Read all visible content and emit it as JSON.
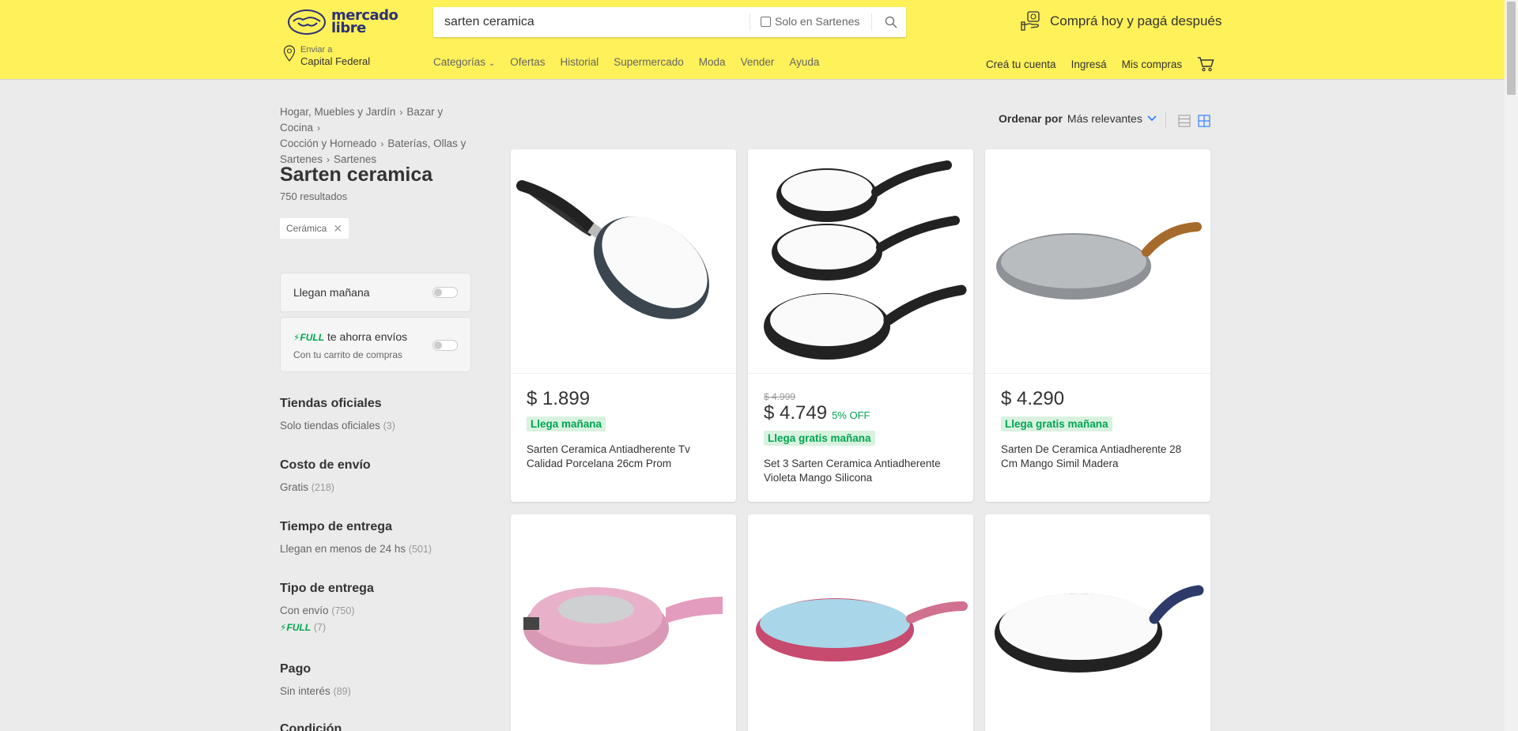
{
  "header": {
    "logo_line1": "mercado",
    "logo_line2": "libre",
    "search_value": "sarten ceramica",
    "search_check_label": "Solo en Sartenes",
    "promo_text": "Comprá hoy y pagá después",
    "location_small": "Enviar a",
    "location_main": "Capital Federal",
    "nav": [
      "Categorías",
      "Ofertas",
      "Historial",
      "Supermercado",
      "Moda",
      "Vender",
      "Ayuda"
    ],
    "account": [
      "Creá tu cuenta",
      "Ingresá",
      "Mis compras"
    ]
  },
  "breadcrumb": [
    "Hogar, Muebles y Jardín",
    "Bazar y Cocina",
    "Cocción y Horneado",
    "Baterías, Ollas y Sartenes",
    "Sartenes"
  ],
  "page": {
    "title": "Sarten ceramica",
    "results": "750 resultados",
    "chip": "Cerámica"
  },
  "toggles": {
    "tomorrow": "Llegan mañana",
    "full_badge": "FULL",
    "full_text": "te ahorra envíos",
    "full_sub": "Con tu carrito de compras"
  },
  "filters": [
    {
      "title": "Tiendas oficiales",
      "items": [
        {
          "label": "Solo tiendas oficiales",
          "count": "(3)"
        }
      ]
    },
    {
      "title": "Costo de envío",
      "items": [
        {
          "label": "Gratis",
          "count": "(218)"
        }
      ]
    },
    {
      "title": "Tiempo de entrega",
      "items": [
        {
          "label": "Llegan en menos de 24 hs",
          "count": "(501)"
        }
      ]
    },
    {
      "title": "Tipo de entrega",
      "items": [
        {
          "label": "Con envío",
          "count": "(750)"
        },
        {
          "label": "FULL",
          "count": "(7)"
        }
      ]
    },
    {
      "title": "Pago",
      "items": [
        {
          "label": "Sin interés",
          "count": "(89)"
        }
      ]
    },
    {
      "title": "Condición",
      "items": []
    }
  ],
  "sort": {
    "label": "Ordenar por",
    "value": "Más relevantes"
  },
  "products": [
    {
      "price": "$ 1.899",
      "old_price": "",
      "discount": "",
      "shipping": "Llega mañana",
      "title": "Sarten Ceramica Antiadherente Tv Calidad Porcelana 26cm Prom"
    },
    {
      "price": "$ 4.749",
      "old_price": "$ 4.999",
      "discount": "5% OFF",
      "shipping": "Llega gratis mañana",
      "title": "Set 3 Sarten Ceramica Antiadherente Violeta Mango Silicona"
    },
    {
      "price": "$ 4.290",
      "old_price": "",
      "discount": "",
      "shipping": "Llega gratis mañana",
      "title": "Sarten De Ceramica Antiadherente 28 Cm Mango Simil Madera"
    }
  ],
  "colors": {
    "header": "#fff159",
    "green": "#00a650",
    "accent": "#3483fa"
  }
}
